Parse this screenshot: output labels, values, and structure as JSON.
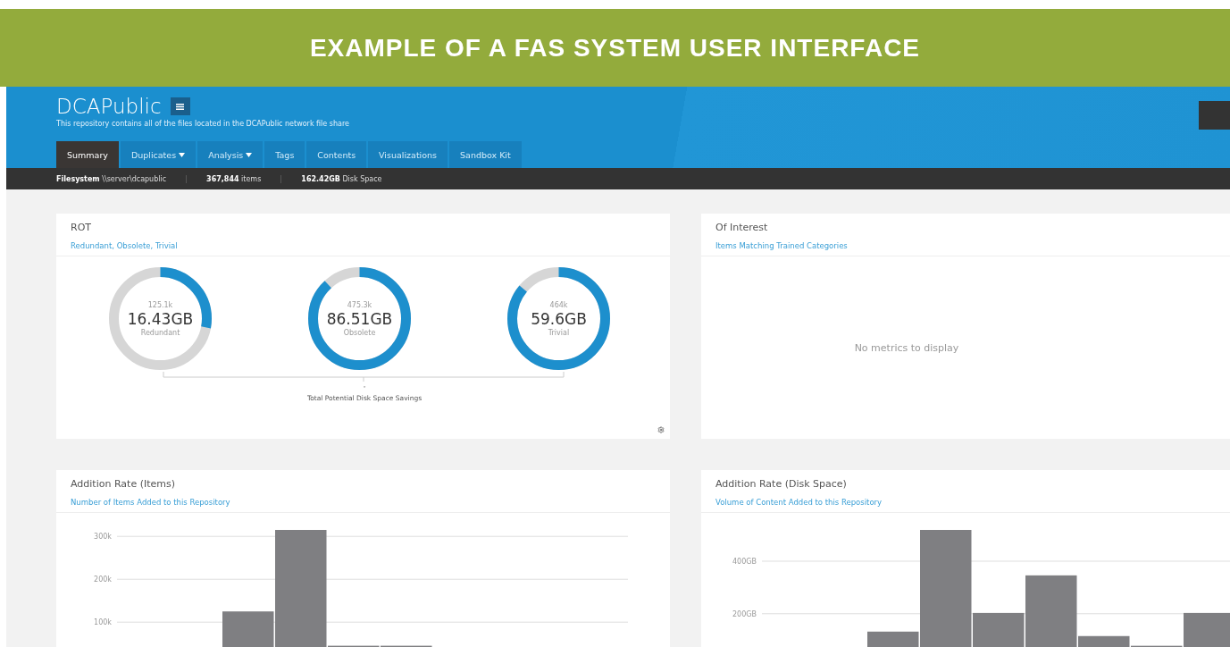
{
  "banner": {
    "title": "EXAMPLE OF A FAS SYSTEM USER INTERFACE"
  },
  "header": {
    "title": "DCAPublic",
    "description": "This repository contains all of the files located in the DCAPublic network file share",
    "tabs": [
      {
        "label": "Summary",
        "selected": true,
        "dropdown": false
      },
      {
        "label": "Duplicates",
        "selected": false,
        "dropdown": true
      },
      {
        "label": "Analysis",
        "selected": false,
        "dropdown": true
      },
      {
        "label": "Tags",
        "selected": false,
        "dropdown": false
      },
      {
        "label": "Contents",
        "selected": false,
        "dropdown": false
      },
      {
        "label": "Visualizations",
        "selected": false,
        "dropdown": false
      },
      {
        "label": "Sandbox Kit",
        "selected": false,
        "dropdown": false
      }
    ]
  },
  "status_bar": [
    "**Filesystem** \\\\server\\dcapublic",
    "**367,844** items",
    "**162.42GB** Disk Space"
  ],
  "rot": {
    "title": "ROT",
    "subtitle": "Redundant, Obsolete, Trivial",
    "donuts": [
      {
        "count": "125.1k",
        "size": "16.43GB",
        "label": "Redundant",
        "level": 0.28
      },
      {
        "count": "475.3k",
        "size": "86.51GB",
        "label": "Obsolete",
        "level": 0.88
      },
      {
        "count": "464k",
        "size": "59.6GB",
        "label": "Trivial",
        "level": 0.86
      }
    ],
    "total_value": "-",
    "total_label": "Total Potential Disk Space Savings"
  },
  "interest": {
    "title": "Of Interest",
    "subtitle": "Items Matching Trained Categories",
    "empty": "No metrics to display"
  },
  "charts": [
    {
      "title": "Addition Rate (Items)",
      "subtitle": "Number of Items Added to this Repository",
      "chart_data": {
        "type": "bar",
        "grid": true,
        "ylim": [
          40,
          315
        ],
        "yticks": [
          {
            "value": 100,
            "label": "100k"
          },
          {
            "value": 200,
            "label": "200k"
          },
          {
            "value": 300,
            "label": "300k"
          }
        ],
        "values": [
          null,
          null,
          125,
          315,
          45,
          45,
          null,
          null,
          null,
          null
        ]
      }
    },
    {
      "title": "Addition Rate (Disk Space)",
      "subtitle": "Volume of Content Added to this Repository",
      "chart_data": {
        "type": "bar",
        "grid": true,
        "ylim": [
          70,
          519
        ],
        "yticks": [
          {
            "value": 200,
            "label": "200GB"
          },
          {
            "value": 400,
            "label": "400GB"
          }
        ],
        "values": [
          null,
          null,
          132,
          519,
          203,
          346,
          115,
          78,
          203
        ]
      }
    }
  ]
}
